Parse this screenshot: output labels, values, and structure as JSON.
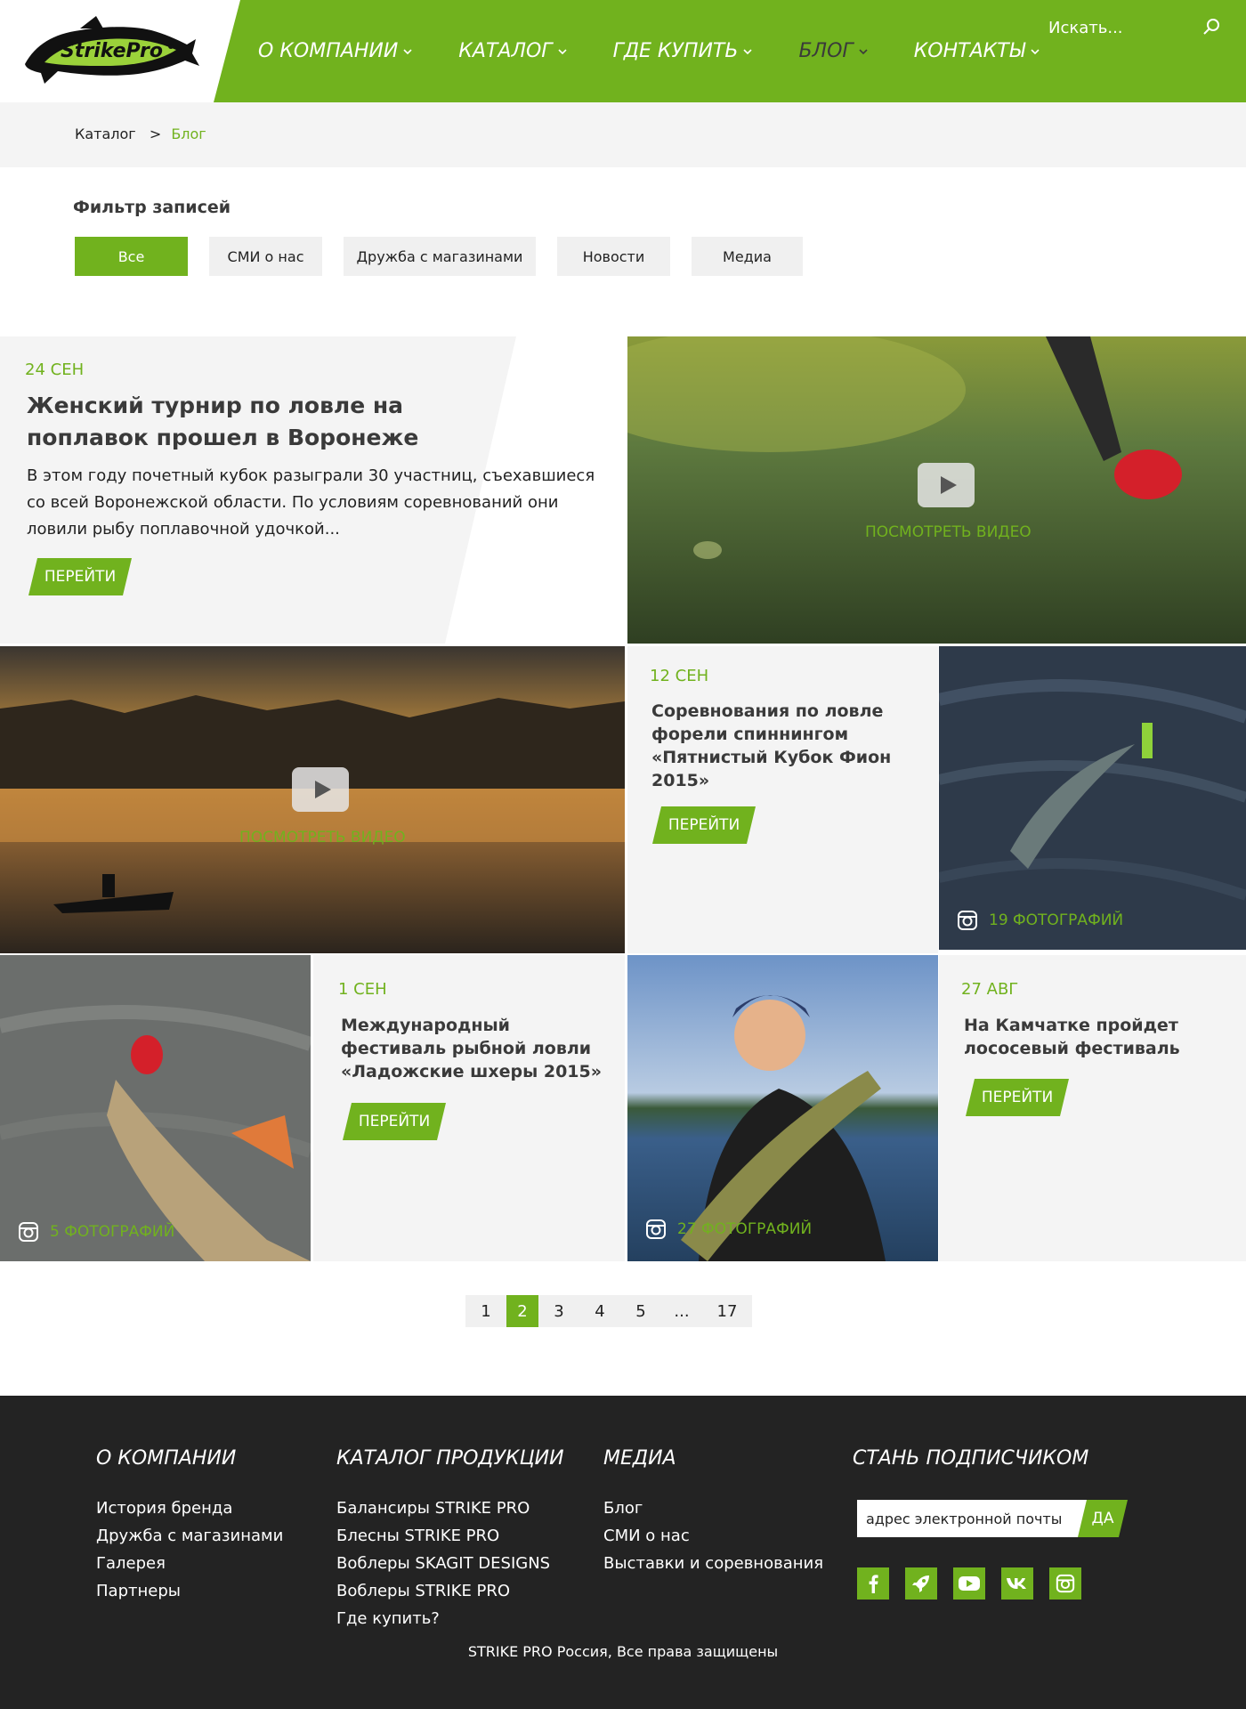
{
  "colors": {
    "accent": "#71b21e",
    "footer_bg": "#232323",
    "tile_bg": "#f4f4f4"
  },
  "header": {
    "logo_text": "StrikePro",
    "nav": [
      {
        "label": "О КОМПАНИИ",
        "icon": "chevron-down-icon"
      },
      {
        "label": "КАТАЛОГ",
        "icon": "chevron-down-icon"
      },
      {
        "label": "ГДЕ КУПИТЬ",
        "icon": "chevron-down-icon"
      },
      {
        "label": "БЛОГ",
        "icon": "chevron-down-icon",
        "active": true
      },
      {
        "label": "КОНТАКТЫ",
        "icon": "chevron-down-icon"
      }
    ],
    "search_placeholder": "Искать...",
    "search_icon": "search-icon"
  },
  "breadcrumb": {
    "parent": "Каталог",
    "separator": ">",
    "current": "Блог"
  },
  "filter": {
    "title": "Фильтр записей",
    "options": [
      {
        "label": "Все",
        "active": true
      },
      {
        "label": "СМИ о нас"
      },
      {
        "label": "Дружба с магазинами"
      },
      {
        "label": "Новости"
      },
      {
        "label": "Медиа"
      }
    ]
  },
  "posts": {
    "p1": {
      "date": "24 СЕН",
      "title": "Женский турнир по ловле на поплавок прошел в Воронеже",
      "excerpt": "В этом году почетный кубок разыграли 30 участниц, съехавшиеся со всей Воронежской области. По условиям соревнований они ловили рыбу поплавочной удочкой...",
      "button": "ПЕРЕЙТИ"
    },
    "v1": {
      "label": "ПОСМОТРЕТЬ ВИДЕО"
    },
    "v2": {
      "label": "ПОСМОТРЕТЬ ВИДЕО"
    },
    "p2": {
      "date": "12 СЕН",
      "title": "Соревнования по ловле форели спиннингом «Пятнистый Кубок Фион 2015»",
      "button": "ПЕРЕЙТИ"
    },
    "g1": {
      "label": "19 ФОТОГРАФИЙ"
    },
    "g2": {
      "label": "5 ФОТОГРАФИЙ"
    },
    "p3": {
      "date": "1 СЕН",
      "title": "Международный фестиваль рыбной ловли «Ладожские шхеры 2015»",
      "button": "ПЕРЕЙТИ"
    },
    "g3": {
      "label": "27 ФОТОГРАФИЙ"
    },
    "p4": {
      "date": "27 АВГ",
      "title": "На Камчатке пройдет лососевый фестиваль",
      "button": "ПЕРЕЙТИ"
    }
  },
  "pagination": {
    "pages": [
      "1",
      "2",
      "3",
      "4",
      "5",
      "...",
      "17"
    ],
    "current": "2"
  },
  "footer": {
    "col1": {
      "heading": "О КОМПАНИИ",
      "links": [
        "История бренда",
        "Дружба с магазинами",
        "Галерея",
        "Партнеры"
      ]
    },
    "col2": {
      "heading": "КАТАЛОГ ПРОДУКЦИИ",
      "links": [
        "Балансиры STRIKE PRO",
        "Блесны STRIKE PRO",
        "Воблеры SKAGIT DESIGNS",
        "Воблеры STRIKE PRO",
        "Где купить?"
      ]
    },
    "col3": {
      "heading": "МЕДИА",
      "links": [
        "Блог",
        "СМИ о нас",
        "Выставки и соревнования"
      ]
    },
    "col4": {
      "heading": "СТАНЬ ПОДПИСЧИКОМ",
      "email_placeholder": "адрес электронной почты",
      "button": "ДА"
    },
    "socials": [
      "facebook-icon",
      "rocket-icon",
      "youtube-icon",
      "vk-icon",
      "instagram-icon"
    ],
    "copyright": "STRIKE PRO Россия, Все права защищены"
  }
}
